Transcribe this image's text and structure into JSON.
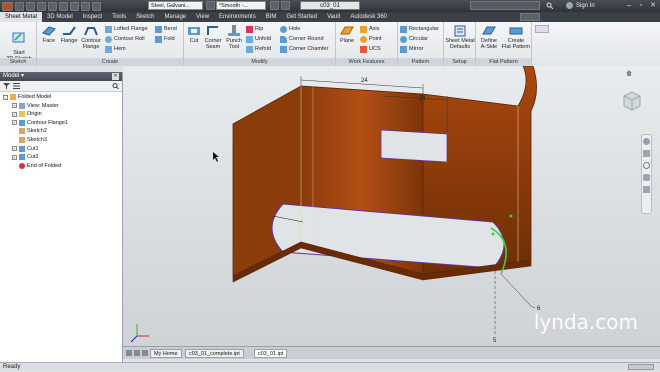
{
  "titlebar": {
    "material": "Steel, Galvani...",
    "appearance": "*Smooth -...",
    "doc_title": "c03_01",
    "sign_in": "Sign In"
  },
  "tabs": [
    "Sheet Metal",
    "3D Model",
    "Inspect",
    "Tools",
    "Sketch",
    "Manage",
    "View",
    "Environments",
    "BIM",
    "Get Started",
    "Vault",
    "Autodesk 360"
  ],
  "ribbon": {
    "sketch": {
      "title": "Sketch",
      "start_sketch": "Start\n2D Sketch"
    },
    "create": {
      "title": "Create",
      "face": "Face",
      "flange": "Flange",
      "contour_flange": "Contour\nFlange",
      "lofted_flange": "Lofted Flange",
      "contour_roll": "Contour Roll",
      "hem": "Hem",
      "bend": "Bend",
      "fold": "Fold"
    },
    "modify": {
      "title": "Modify",
      "cut": "Cut",
      "corner_seam": "Corner\nSeam",
      "punch_tool": "Punch\nTool",
      "rip": "Rip",
      "unfold": "Unfold",
      "refold": "Refold",
      "hole": "Hole",
      "corner_round": "Corner Round",
      "corner_chamfer": "Corner Chamfer"
    },
    "work": {
      "title": "Work Features",
      "plane": "Plane",
      "axis": "Axis",
      "point": "Point",
      "ucs": "UCS"
    },
    "pattern": {
      "title": "Pattern",
      "rectangular": "Rectangular",
      "circular": "Circular",
      "mirror": "Mirror"
    },
    "setup": {
      "title": "Setup",
      "defaults": "Sheet Metal\nDefaults"
    },
    "flat": {
      "title": "Flat Pattern",
      "define_aside": "Define\nA-Side",
      "create_flat": "Create\nFlat Pattern"
    }
  },
  "browser": {
    "title": "Model",
    "tree": [
      {
        "label": "Folded Model",
        "level": 0,
        "expander": "-",
        "icon": "part-icon"
      },
      {
        "label": "View: Master",
        "level": 1,
        "expander": "+",
        "icon": "view-icon"
      },
      {
        "label": "Origin",
        "level": 1,
        "expander": "+",
        "icon": "folder-icon"
      },
      {
        "label": "Contour Flange1",
        "level": 1,
        "expander": "+",
        "icon": "flange-icon"
      },
      {
        "label": "Sketch2",
        "level": 1,
        "expander": "",
        "icon": "sketch-icon"
      },
      {
        "label": "Sketch3",
        "level": 1,
        "expander": "",
        "icon": "sketch-icon"
      },
      {
        "label": "Cut1",
        "level": 1,
        "expander": "+",
        "icon": "cut-icon"
      },
      {
        "label": "Cut2",
        "level": 1,
        "expander": "+",
        "icon": "cut-icon"
      },
      {
        "label": "End of Folded",
        "level": 1,
        "expander": "",
        "icon": "end-icon"
      }
    ]
  },
  "viewport": {
    "dims": [
      "24",
      "24"
    ],
    "dim_callout": "6",
    "dim_bottom": "5"
  },
  "doctabs": [
    "My Home",
    "c03_01_complete.ipt",
    "c03_01.ipt"
  ],
  "status": "Ready",
  "watermark": "lynda.com",
  "colors": {
    "part": "#a34a10",
    "part_dark": "#7a3508",
    "ribbon": "#e6eaee",
    "titlebar": "#34383f"
  }
}
